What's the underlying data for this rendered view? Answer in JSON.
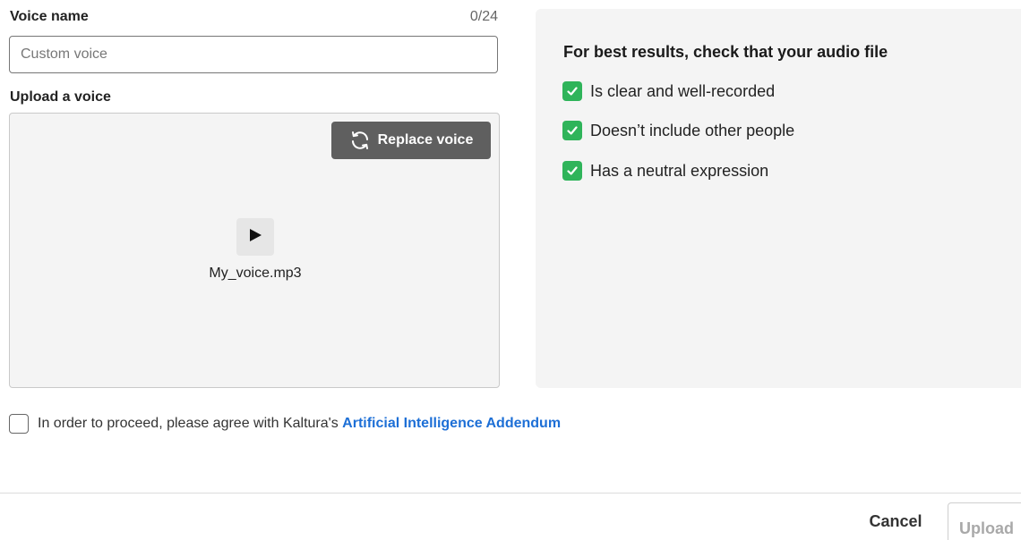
{
  "form": {
    "voice_name_label": "Voice name",
    "voice_name_counter": "0/24",
    "voice_name_placeholder": "Custom voice",
    "voice_name_value": "",
    "upload_label": "Upload a voice"
  },
  "upload": {
    "replace_label": "Replace voice",
    "replace_icon": "refresh-icon",
    "play_icon": "play-icon",
    "file_name": "My_voice.mp3"
  },
  "tips": {
    "title": "For best results, check that your audio file",
    "items": [
      {
        "label": "Is clear and well-recorded",
        "checked": true
      },
      {
        "label": "Doesn’t include other people",
        "checked": true
      },
      {
        "label": "Has a neutral expression",
        "checked": true
      }
    ],
    "check_color": "#2fb45a"
  },
  "agreement": {
    "checked": false,
    "text": "In order to proceed, please agree with Kaltura's",
    "link_label": "Artificial Intelligence Addendum",
    "link_color": "#1d6fd6"
  },
  "footer": {
    "cancel_label": "Cancel",
    "upload_label": "Upload",
    "upload_disabled": true
  }
}
